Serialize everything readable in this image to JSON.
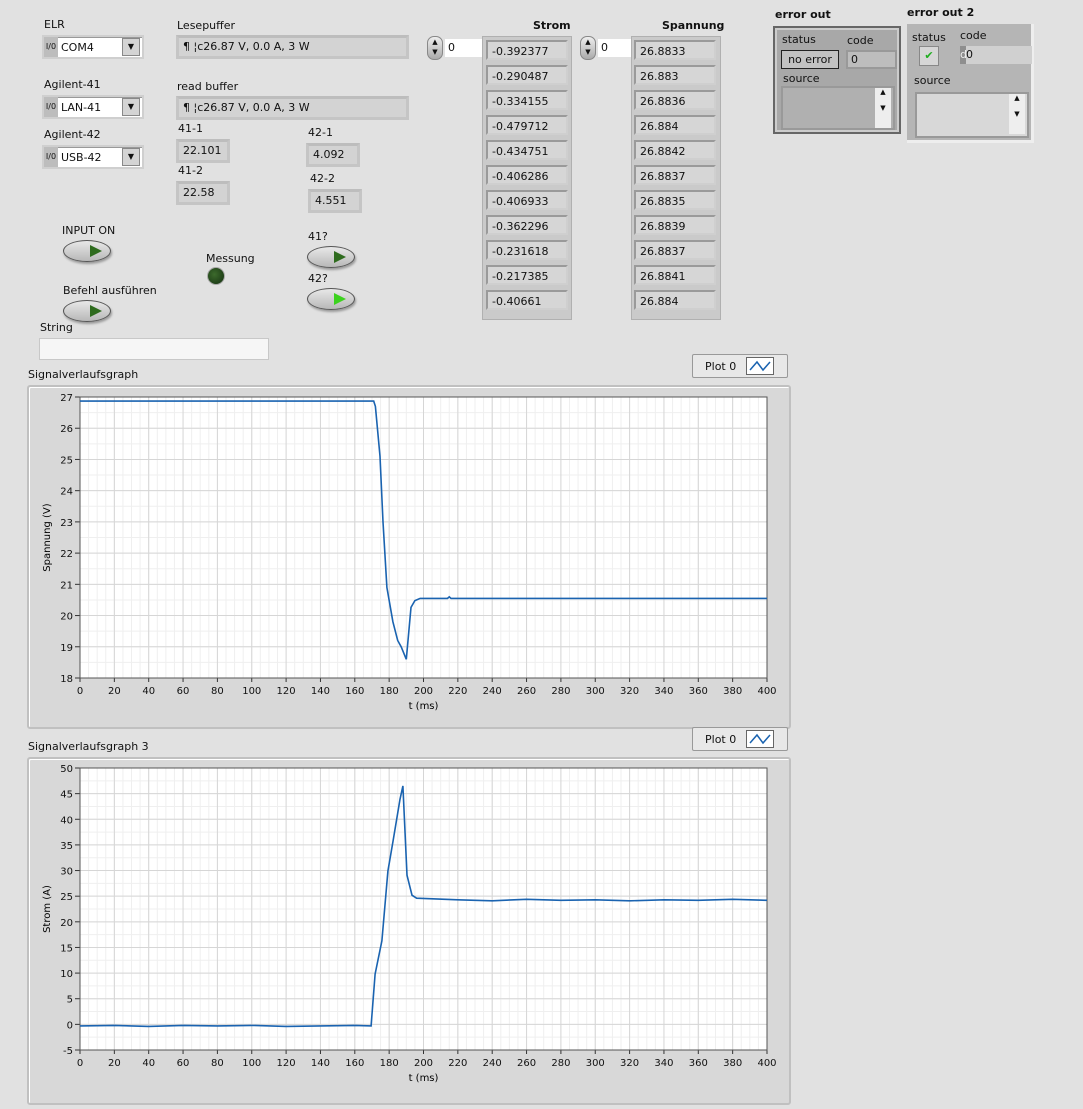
{
  "controls": {
    "elr": {
      "label": "ELR",
      "value": "COM4"
    },
    "agilent41": {
      "label": "Agilent-41",
      "value": "LAN-41"
    },
    "agilent42": {
      "label": "Agilent-42",
      "value": "USB-42"
    },
    "io_glyph": "I/0",
    "lesepuffer": {
      "label": "Lesepuffer",
      "value": "¶ ¦c26.87 V, 0.0 A, 3 W"
    },
    "read_buffer": {
      "label": "read buffer",
      "value": "¶ ¦c26.87 V, 0.0 A, 3 W"
    },
    "v41_1": {
      "label": "41-1",
      "value": "22.101"
    },
    "v41_2": {
      "label": "41-2",
      "value": "22.58"
    },
    "v42_1": {
      "label": "42-1",
      "value": "4.092"
    },
    "v42_2": {
      "label": "42-2",
      "value": "4.551"
    },
    "input_on": {
      "label": "INPUT ON",
      "state": false
    },
    "befehl": {
      "label": "Befehl ausführen",
      "state": false
    },
    "messung": {
      "label": "Messung",
      "state": false
    },
    "q41": {
      "label": "41?",
      "state": false
    },
    "q42": {
      "label": "42?",
      "state": true
    },
    "string": {
      "label": "String",
      "value": ""
    }
  },
  "arrays": {
    "strom": {
      "label": "Strom",
      "index": "0",
      "values": [
        "-0.392377",
        "-0.290487",
        "-0.334155",
        "-0.479712",
        "-0.434751",
        "-0.406286",
        "-0.406933",
        "-0.362296",
        "-0.231618",
        "-0.217385",
        "-0.40661"
      ]
    },
    "spannung": {
      "label": "Spannung",
      "index": "0",
      "values": [
        "26.8833",
        "26.883",
        "26.8836",
        "26.884",
        "26.8842",
        "26.8837",
        "26.8835",
        "26.8839",
        "26.8837",
        "26.8841",
        "26.884"
      ]
    }
  },
  "errors": {
    "error_out": {
      "label": "error out",
      "status_label": "status",
      "status_value": "no error",
      "code_label": "code",
      "code_value": "0",
      "source_label": "source",
      "source_value": ""
    },
    "error_out2": {
      "label": "error out 2",
      "status_label": "status",
      "code_label": "code",
      "code_prefix": "d",
      "code_value": "0",
      "source_label": "source",
      "source_value": "",
      "status_ok": true
    }
  },
  "chart_data": [
    {
      "type": "line",
      "title": "Signalverlaufsgraph",
      "legend": "Plot 0",
      "legend_placement": "top-right",
      "xlabel": "t (ms)",
      "ylabel": "Spannung (V)",
      "xlim": [
        0,
        400
      ],
      "ylim": [
        18,
        27
      ],
      "xticks": [
        0,
        20,
        40,
        60,
        80,
        100,
        120,
        140,
        160,
        180,
        200,
        220,
        240,
        260,
        280,
        300,
        320,
        340,
        360,
        380,
        400
      ],
      "yticks": [
        18,
        19,
        20,
        21,
        22,
        23,
        24,
        25,
        26,
        27
      ],
      "grid": true,
      "color": "#1a63b0",
      "x": [
        0,
        171,
        172,
        174.7,
        176.4,
        178.7,
        182.2,
        185,
        187,
        190,
        192.7,
        195,
        198,
        214,
        215,
        216,
        400
      ],
      "y": [
        26.87,
        26.87,
        26.7,
        25.1,
        23.0,
        20.9,
        19.8,
        19.2,
        19.0,
        18.6,
        20.26,
        20.48,
        20.55,
        20.55,
        20.6,
        20.55,
        20.55
      ]
    },
    {
      "type": "line",
      "title": "Signalverlaufsgraph 3",
      "legend": "Plot 0",
      "legend_placement": "top-right",
      "xlabel": "t (ms)",
      "ylabel": "Strom (A)",
      "xlim": [
        0,
        400
      ],
      "ylim": [
        -5,
        50
      ],
      "xticks": [
        0,
        20,
        40,
        60,
        80,
        100,
        120,
        140,
        160,
        180,
        200,
        220,
        240,
        260,
        280,
        300,
        320,
        340,
        360,
        380,
        400
      ],
      "yticks": [
        -5,
        0,
        5,
        10,
        15,
        20,
        25,
        30,
        35,
        40,
        45,
        50
      ],
      "grid": true,
      "color": "#1a63b0",
      "x": [
        0,
        20,
        40,
        60,
        80,
        100,
        120,
        140,
        160,
        169.5,
        171.8,
        175.8,
        179.3,
        182.3,
        186.3,
        188,
        190.4,
        193.3,
        196,
        220,
        240,
        260,
        280,
        300,
        320,
        340,
        360,
        380,
        400
      ],
      "y": [
        -0.3,
        -0.2,
        -0.4,
        -0.2,
        -0.3,
        -0.2,
        -0.4,
        -0.3,
        -0.2,
        -0.3,
        9.8,
        16.3,
        29.9,
        35.8,
        43.9,
        46.5,
        29.1,
        25.2,
        24.6,
        24.3,
        24.1,
        24.4,
        24.2,
        24.3,
        24.1,
        24.3,
        24.2,
        24.4,
        24.2
      ]
    }
  ]
}
